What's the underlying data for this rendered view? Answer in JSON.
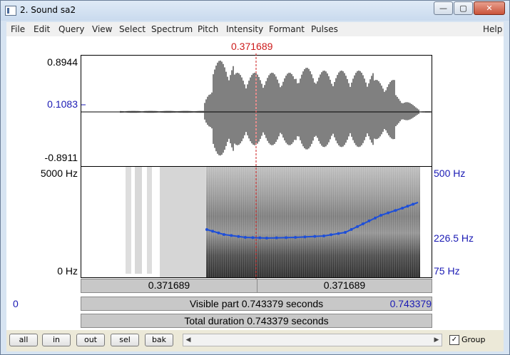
{
  "window": {
    "title": "2. Sound sa2",
    "buttons": {
      "minimize": "—",
      "maximize": "▢",
      "close": "✕"
    }
  },
  "menu": [
    "File",
    "Edit",
    "Query",
    "View",
    "Select",
    "Spectrum",
    "Pitch",
    "Intensity",
    "Formant",
    "Pulses",
    "Help"
  ],
  "cursor": {
    "time": "0.371689"
  },
  "waveform": {
    "max": "0.8944",
    "cursor_value": "0.1083",
    "min": "-0.8911"
  },
  "spectrogram": {
    "freq_max": "5000 Hz",
    "freq_min": "0 Hz"
  },
  "pitch": {
    "max": "500 Hz",
    "mid": "226.5 Hz",
    "min": "75 Hz",
    "color": "#1e4fd8"
  },
  "time_bar": {
    "left": "0.371689",
    "right": "0.371689"
  },
  "visible_bar": {
    "start": "0",
    "label": "Visible part 0.743379 seconds",
    "end": "0.743379"
  },
  "total_bar": {
    "label": "Total duration 0.743379 seconds"
  },
  "bottom": {
    "buttons": [
      "all",
      "in",
      "out",
      "sel",
      "bak"
    ],
    "group_label": "Group",
    "group_checked": true
  },
  "colors": {
    "cursor": "#cc1a1a",
    "blue_axis": "#1a1ab4"
  }
}
